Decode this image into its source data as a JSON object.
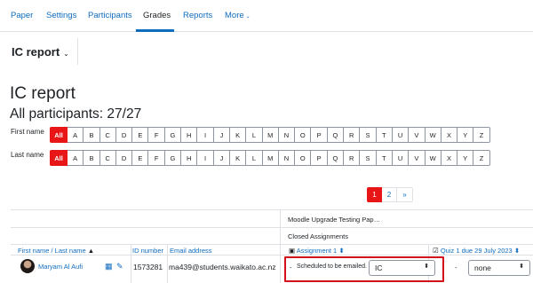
{
  "nav": {
    "tabs": [
      {
        "label": "Paper"
      },
      {
        "label": "Settings"
      },
      {
        "label": "Participants"
      },
      {
        "label": "Grades"
      },
      {
        "label": "Reports"
      },
      {
        "label": "More"
      }
    ],
    "active": "Grades"
  },
  "report_selector": {
    "label": "IC report"
  },
  "page": {
    "title": "IC report",
    "participants": "All participants: 27/27"
  },
  "first_name_filter": {
    "label": "First name",
    "all": "All"
  },
  "last_name_filter": {
    "label": "Last name",
    "all": "All"
  },
  "letters": [
    "A",
    "B",
    "C",
    "D",
    "E",
    "F",
    "G",
    "H",
    "I",
    "J",
    "K",
    "L",
    "M",
    "N",
    "O",
    "P",
    "Q",
    "R",
    "S",
    "T",
    "U",
    "V",
    "W",
    "X",
    "Y",
    "Z"
  ],
  "pagination": {
    "pages": [
      "1",
      "2"
    ],
    "current": "1",
    "next": "»"
  },
  "table": {
    "group_header": "Moodle Upgrade Testing Pap…",
    "subgroup_header": "Closed Assignments",
    "columns": {
      "name": "First name / Last name",
      "id": "ID number",
      "email": "Email address",
      "assignment": "Assignment 1",
      "quiz": "Quiz 1 due 29 July 2023"
    },
    "rows": [
      {
        "name": "Maryam Al Aufi",
        "id": "1573281",
        "email": "ma439@students.waikato.ac.nz",
        "prefix": "-",
        "status": "Scheduled to be emailed.",
        "assignment_value": "IC",
        "quiz_prefix": "-",
        "quiz_value": "none"
      }
    ]
  },
  "colors": {
    "accent": "#0f6cbf",
    "selected": "#e81616",
    "highlight": "#d4101d"
  },
  "icons": [
    "chevron-down-icon",
    "sort-up-icon",
    "sort-icon",
    "grade-icon",
    "edit-icon",
    "assignment-icon",
    "quiz-icon"
  ]
}
